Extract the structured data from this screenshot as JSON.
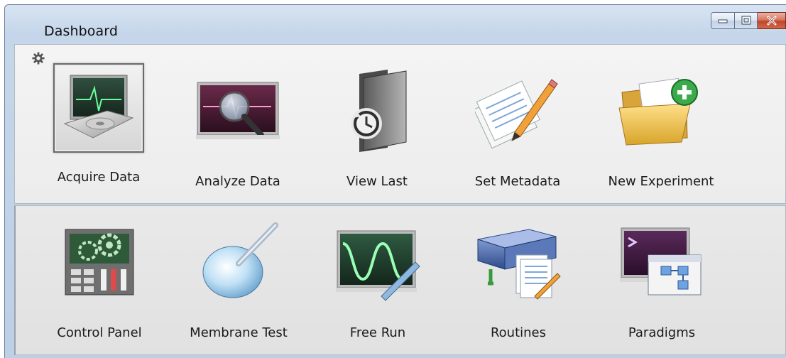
{
  "window": {
    "title": "Dashboard"
  },
  "top_row": [
    {
      "label": "Acquire Data",
      "icon": "acquire-data-icon"
    },
    {
      "label": "Analyze Data",
      "icon": "analyze-data-icon"
    },
    {
      "label": "View Last",
      "icon": "view-last-icon"
    },
    {
      "label": "Set Metadata",
      "icon": "set-metadata-icon"
    },
    {
      "label": "New Experiment",
      "icon": "new-experiment-icon"
    }
  ],
  "bottom_row": [
    {
      "label": "Control Panel",
      "icon": "control-panel-icon"
    },
    {
      "label": "Membrane Test",
      "icon": "membrane-test-icon"
    },
    {
      "label": "Free Run",
      "icon": "free-run-icon"
    },
    {
      "label": "Routines",
      "icon": "routines-icon"
    },
    {
      "label": "Paradigms",
      "icon": "paradigms-icon"
    }
  ],
  "colors": {
    "titlebar": "#c5d6ea",
    "panel_top": "#f0f0f0",
    "panel_bottom": "#e5e5e5",
    "close_button": "#c2452a"
  }
}
